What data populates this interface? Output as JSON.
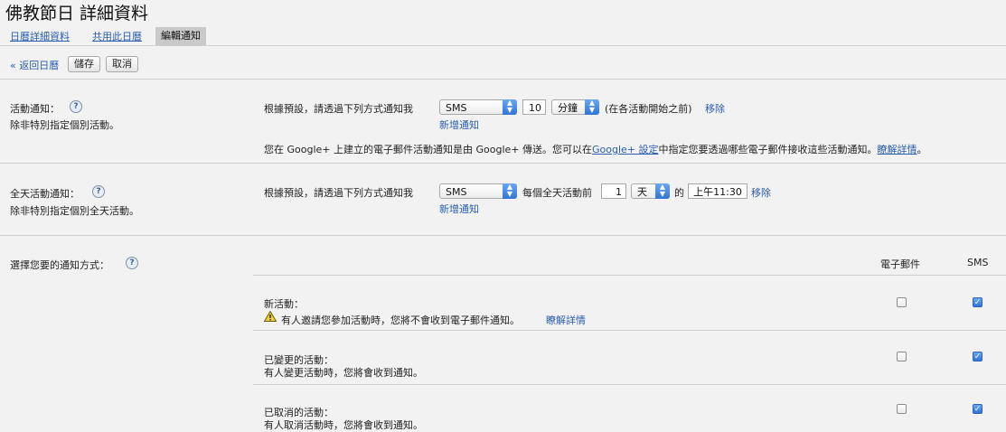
{
  "page": {
    "title": "佛教節日 詳細資料"
  },
  "tabs": [
    {
      "label": "日曆詳細資料"
    },
    {
      "label": "共用此日曆"
    },
    {
      "label": "編輯通知"
    }
  ],
  "toolbar": {
    "back_label": "« 返回日曆",
    "save_label": "儲存",
    "cancel_label": "取消"
  },
  "event_notification": {
    "title": "活動通知：",
    "desc": "除非特別指定個別活動。",
    "prefix": "根據預設，請透過下列方式通知我",
    "method": "SMS",
    "amount": "10",
    "unit": "分鐘",
    "suffix": "(在各活動開始之前)",
    "remove_label": "移除",
    "add_label": "新增通知",
    "gplus_before": "您在 Google+ 上建立的電子郵件活動通知是由 Google+ 傳送。您可以在",
    "gplus_link": "Google+ 設定",
    "gplus_after": "中指定您要透過哪些電子郵件接收這些活動通知。",
    "learn_more": "瞭解詳情",
    "gplus_end": "。"
  },
  "allday_notification": {
    "title": "全天活動通知：",
    "desc": "除非特別指定個別全天活動。",
    "prefix": "根據預設，請透過下列方式通知我",
    "method": "SMS",
    "before_text": "每個全天活動前",
    "amount": "1",
    "unit": "天",
    "of_text": "的",
    "time": "上午11:30",
    "remove_label": "移除",
    "add_label": "新增通知"
  },
  "choose_method": {
    "title": "選擇您要的通知方式：",
    "col_email": "電子郵件",
    "col_sms": "SMS",
    "rows": [
      {
        "title": "新活動：",
        "desc": "有人邀請您參加活動時，您將不會收到電子郵件通知。",
        "link": "瞭解詳情",
        "email": false,
        "sms": true
      },
      {
        "title": "已變更的活動：",
        "desc": "有人變更活動時，您將會收到通知。",
        "email": false,
        "sms": true
      },
      {
        "title": "已取消的活動：",
        "desc": "有人取消活動時，您將會收到通知。",
        "email": false,
        "sms": true
      }
    ]
  },
  "icons": {
    "help": "help-icon",
    "warning": "warning-icon",
    "dropdown": "updown-arrow-icon",
    "check": "checkmark-icon"
  }
}
